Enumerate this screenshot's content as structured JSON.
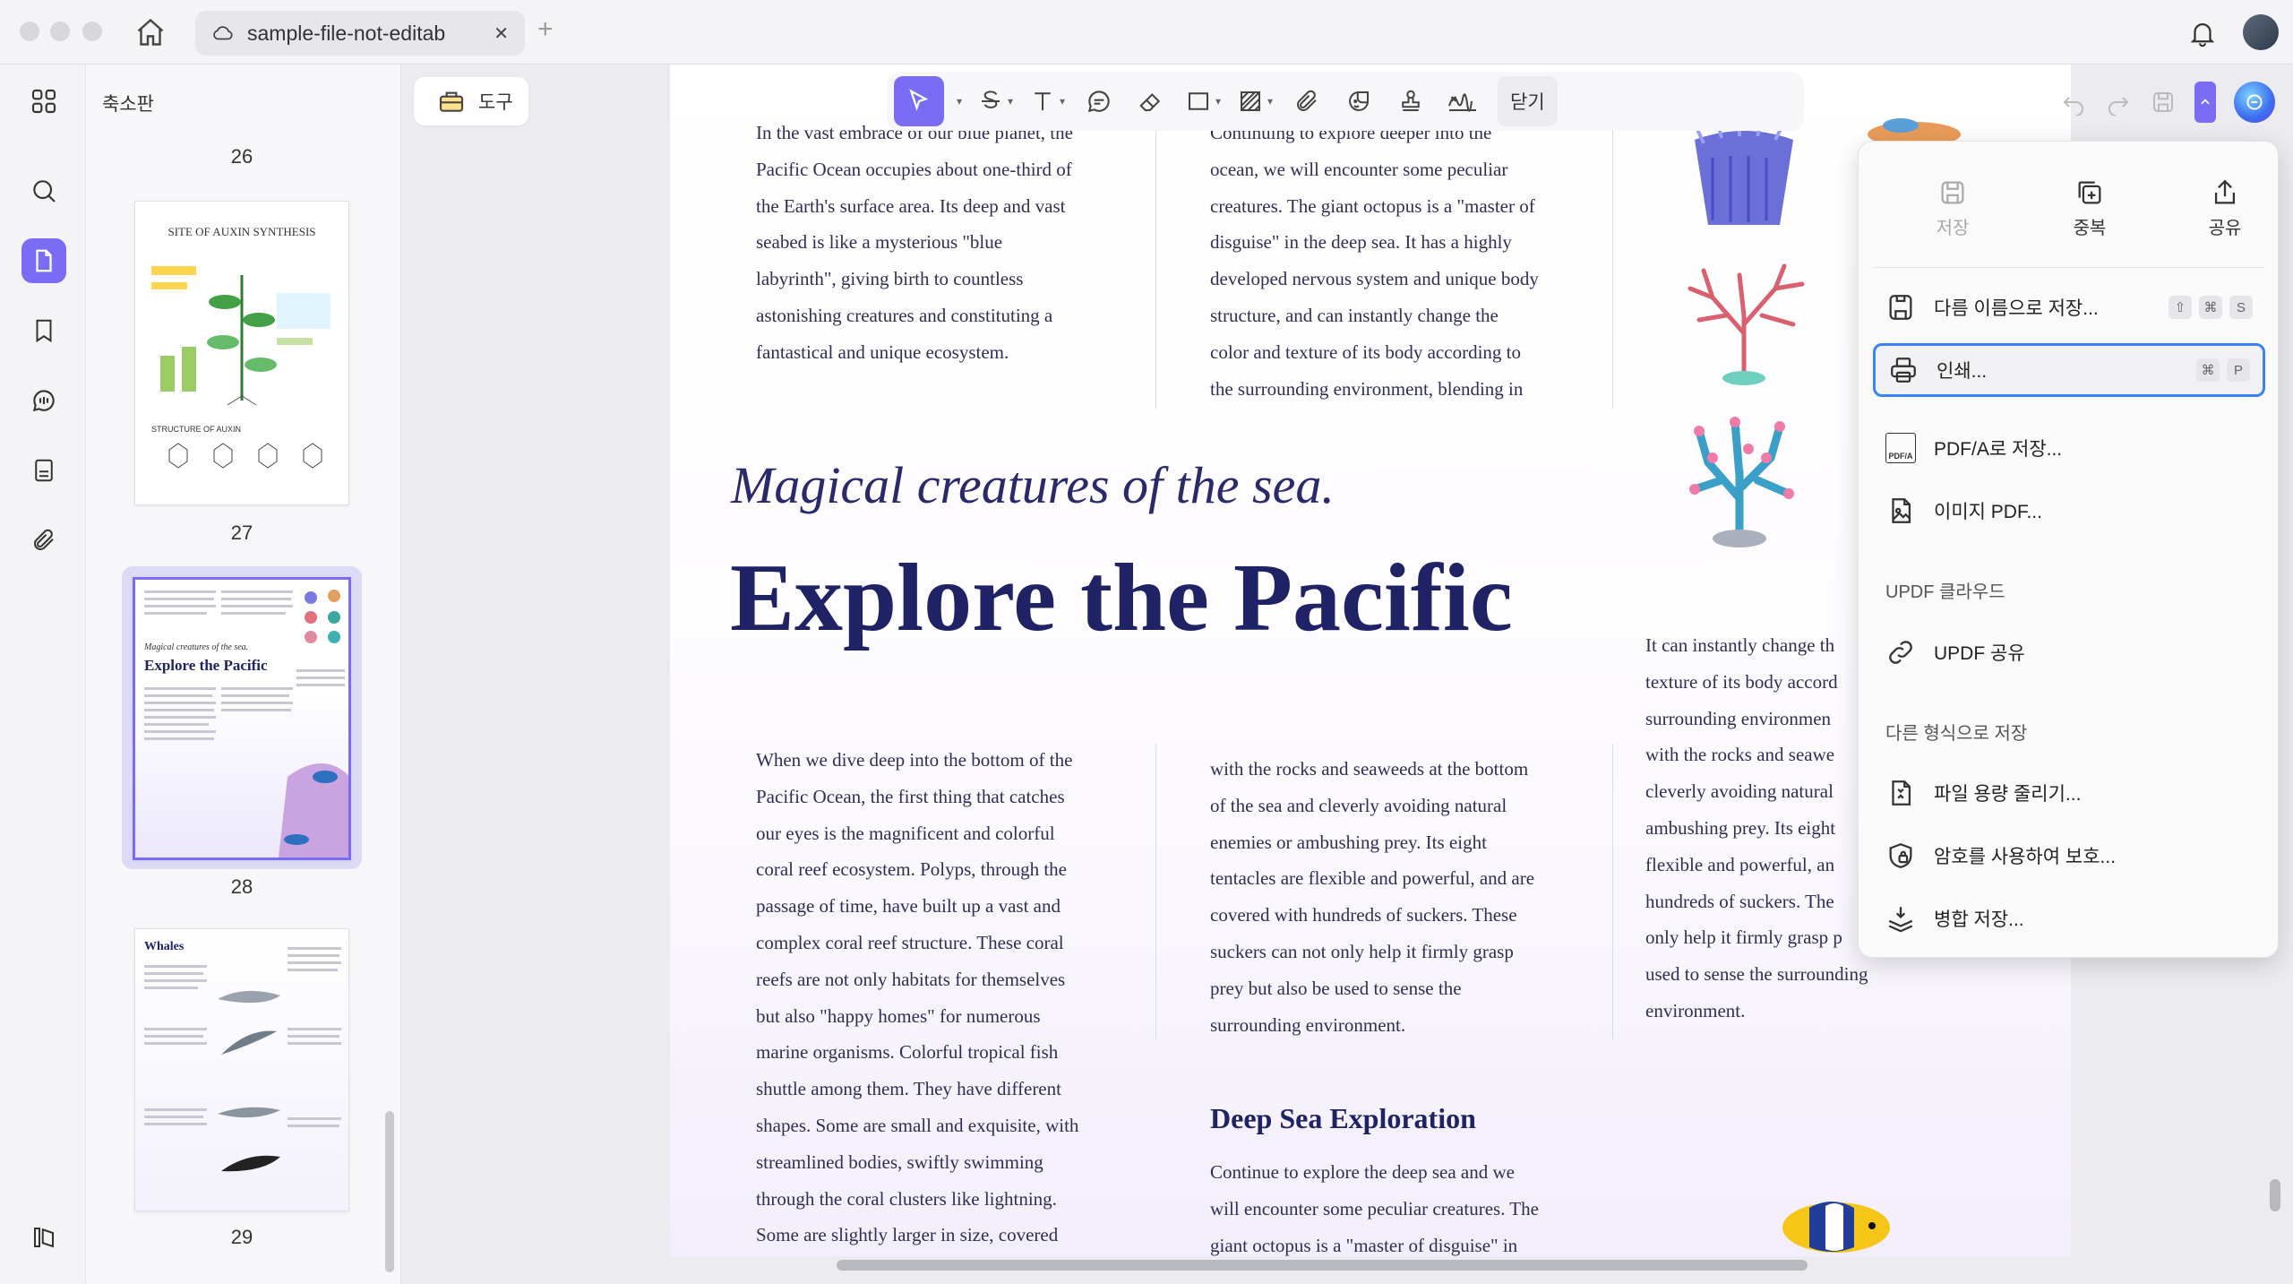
{
  "window": {
    "tab_title": "sample-file-not-editab",
    "tab_icon": "cloud-icon",
    "new_tab": "+",
    "close_tab": "✕"
  },
  "sidebar": {
    "panel_title": "축소판",
    "icons": [
      "grid-icon",
      "search-icon",
      "page-icon",
      "bookmark-icon",
      "comment-icon",
      "form-icon",
      "attachment-icon",
      "layers-icon"
    ]
  },
  "thumbnails": {
    "page_numbers": [
      "26",
      "27",
      "28",
      "29"
    ],
    "thumb27_title": "SITE OF AUXIN SYNTHESIS",
    "thumb27_subtitle": "STRUCTURE OF AUXIN",
    "thumb28_subtitle": "Magical creatures of the sea.",
    "thumb28_title": "Explore the Pacific",
    "thumb29_title": "Whales"
  },
  "toolbar": {
    "tools_label": "도구",
    "close_label": "닫기",
    "accent": "#7b6cf6"
  },
  "document": {
    "col1_top": [
      "In the vast embrace of our blue planet, the",
      "Pacific Ocean occupies about one-third of",
      "the Earth's surface area. Its deep and vast",
      "seabed is like a mysterious \"blue",
      "labyrinth\", giving birth to countless",
      "astonishing creatures and constituting a",
      "fantastical and unique ecosystem."
    ],
    "col2_top": [
      "Continuing to explore deeper into the",
      "ocean, we will encounter some peculiar",
      "creatures. The giant octopus is a \"master of",
      "disguise\" in the deep sea. It has a highly",
      "developed nervous system and unique body",
      "structure, and can instantly change the",
      "color and texture of its body according to",
      "the surrounding environment, blending in"
    ],
    "subtitle": "Magical creatures of the sea.",
    "title": "Explore the Pacific",
    "col1_bottom": [
      "When we dive deep into the bottom of the",
      "Pacific Ocean, the first thing that catches",
      "our eyes is the magnificent and colorful",
      "coral reef ecosystem. Polyps, through the",
      "passage of time, have built up a vast and",
      "complex coral reef structure. These coral",
      "reefs are not only habitats for themselves",
      "but also \"happy homes\" for numerous",
      "marine organisms. Colorful tropical fish",
      "shuttle among them. They have different",
      "shapes. Some are small and exquisite, with",
      "streamlined bodies, swiftly swimming",
      "through the coral clusters like lightning.",
      "Some are slightly larger in size, covered"
    ],
    "col2_bottom": [
      "with the rocks and seaweeds at the bottom",
      "of the sea and cleverly avoiding natural",
      "enemies or ambushing prey. Its eight",
      "tentacles are flexible and powerful, and are",
      "covered with hundreds of suckers. These",
      "suckers can not only help it firmly grasp",
      "prey but also be used to sense the",
      "surrounding environment."
    ],
    "section_heading": "Deep Sea Exploration",
    "col2_after_heading": [
      "Continue to explore the deep sea and we",
      "will encounter some peculiar creatures. The",
      "giant octopus is a \"master of disguise\" in"
    ],
    "col3": [
      "It can instantly change th",
      "texture of its body accord",
      "surrounding environmen",
      "with the rocks and seawe",
      "cleverly avoiding natural",
      "ambushing prey. Its eight",
      "flexible and powerful, an",
      "hundreds of suckers. The",
      "only help it firmly grasp p",
      "used to sense the surrounding",
      "environment."
    ],
    "title_color": "#1f2366"
  },
  "menu": {
    "top": {
      "save": "저장",
      "duplicate": "중복",
      "share": "공유"
    },
    "items": {
      "save_as": "다름 이름으로 저장...",
      "print": "인쇄...",
      "pdfa": "PDF/A로 저장...",
      "image_pdf": "이미지 PDF...",
      "updf_share": "UPDF 공유",
      "reduce": "파일 용량 줄리기...",
      "protect": "암호를 사용하여 보호...",
      "flatten": "병합 저장..."
    },
    "sections": {
      "cloud": "UPDF 클라우드",
      "other_format": "다른 형식으로 저장"
    },
    "shortcuts": {
      "save_as": [
        "⇧",
        "⌘",
        "S"
      ],
      "print": [
        "⌘",
        "P"
      ]
    },
    "pdfa_badge": "PDF/A"
  }
}
